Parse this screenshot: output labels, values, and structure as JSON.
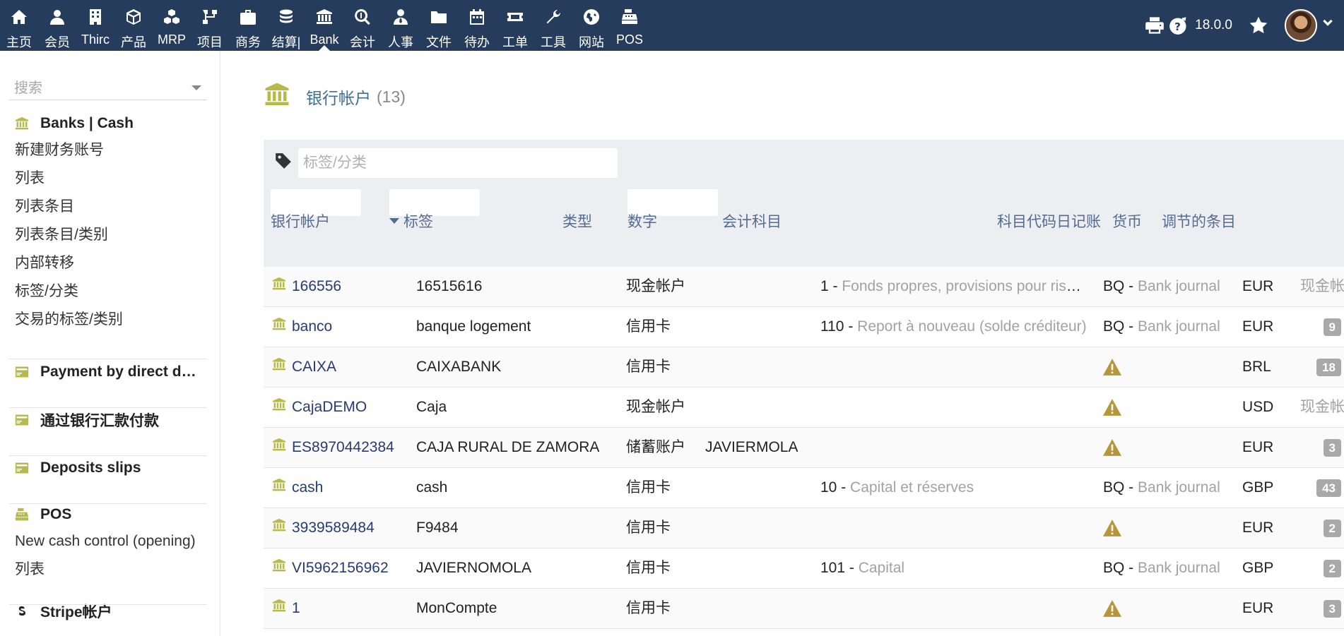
{
  "topnav": {
    "items": [
      {
        "label": "主页",
        "icon": "home-icon"
      },
      {
        "label": "会员",
        "icon": "user-icon"
      },
      {
        "label": "Thirc",
        "icon": "building-icon"
      },
      {
        "label": "产品",
        "icon": "cube-icon"
      },
      {
        "label": "MRP",
        "icon": "cubes-icon"
      },
      {
        "label": "项目",
        "icon": "sitemap-icon"
      },
      {
        "label": "商务",
        "icon": "suitcase-icon"
      },
      {
        "label": "结算|",
        "icon": "coins-icon"
      },
      {
        "label": "Bank",
        "icon": "bank-icon"
      },
      {
        "label": "会计",
        "icon": "search-dollar-icon"
      },
      {
        "label": "人事",
        "icon": "user-tie-icon"
      },
      {
        "label": "文件",
        "icon": "folder-icon"
      },
      {
        "label": "待办",
        "icon": "calendar-icon"
      },
      {
        "label": "工单",
        "icon": "ticket-icon"
      },
      {
        "label": "工具",
        "icon": "wrench-icon"
      },
      {
        "label": "网站",
        "icon": "globe-icon"
      },
      {
        "label": "POS",
        "icon": "cash-register-icon"
      }
    ],
    "active": "Bank"
  },
  "topright": {
    "version": "18.0.0"
  },
  "sidebar": {
    "search_placeholder": "搜索",
    "sections": [
      {
        "title": "Banks | Cash",
        "icon": "bank-icon",
        "links": [
          "新建财务账号",
          "列表",
          "列表条目",
          "列表条目/类别",
          "内部转移",
          "标签/分类",
          "交易的标签/类别"
        ]
      },
      {
        "title": "Payment by direct debit",
        "icon": "credit-card-icon",
        "links": []
      },
      {
        "title": "通过银行汇款付款",
        "icon": "credit-card-icon",
        "links": []
      },
      {
        "title": "Deposits slips",
        "icon": "credit-card-icon",
        "links": []
      },
      {
        "title": "POS",
        "icon": "cash-register-icon",
        "links": [
          "New cash control (opening)",
          "列表"
        ]
      },
      {
        "title": "Stripe帐户",
        "icon": "stripe-s-icon",
        "links": []
      }
    ]
  },
  "page": {
    "title": "银行帐户",
    "count": "(13)"
  },
  "filters": {
    "tag_placeholder": "标签/分类"
  },
  "table": {
    "headers": {
      "account": "银行帐户",
      "label": "标签",
      "type": "类型",
      "number": "数字",
      "accounting": "会计科目",
      "journal": "科目代码日记账",
      "currency": "货币",
      "adjust": "调节的条目"
    },
    "rows": [
      {
        "account": "166556",
        "label": "16515616",
        "type": "现金帐户",
        "number": "",
        "acc_code": "1 - ",
        "acc_name": "Fonds propres, provisions pour risques et charges",
        "jnl_code": "BQ - ",
        "jnl_name": "Bank journal",
        "warn": false,
        "currency": "EUR",
        "adjust": "现金帐户",
        "adjust_kind": "text"
      },
      {
        "account": "banco",
        "label": "banque logement",
        "type": "信用卡",
        "number": "",
        "acc_code": "110 - ",
        "acc_name": "Report à nouveau (solde créditeur)",
        "jnl_code": "BQ - ",
        "jnl_name": "Bank journal",
        "warn": false,
        "currency": "EUR",
        "adjust": "9",
        "adjust_kind": "badge"
      },
      {
        "account": "CAIXA",
        "label": "CAIXABANK",
        "type": "信用卡",
        "number": "",
        "acc_code": "",
        "acc_name": "",
        "jnl_code": "",
        "jnl_name": "",
        "warn": true,
        "currency": "BRL",
        "adjust": "18",
        "adjust_kind": "badge"
      },
      {
        "account": "CajaDEMO",
        "label": "Caja",
        "type": "现金帐户",
        "number": "",
        "acc_code": "",
        "acc_name": "",
        "jnl_code": "",
        "jnl_name": "",
        "warn": true,
        "currency": "USD",
        "adjust": "现金帐户",
        "adjust_kind": "text"
      },
      {
        "account": "ES8970442384",
        "label": "CAJA RURAL DE ZAMORA",
        "type": "储蓄账户",
        "number": "JAVIERMOLA",
        "acc_code": "",
        "acc_name": "",
        "jnl_code": "",
        "jnl_name": "",
        "warn": true,
        "currency": "EUR",
        "adjust": "3",
        "adjust_kind": "badge"
      },
      {
        "account": "cash",
        "label": "cash",
        "type": "信用卡",
        "number": "",
        "acc_code": "10 - ",
        "acc_name": "Capital et réserves",
        "jnl_code": "BQ - ",
        "jnl_name": "Bank journal",
        "warn": false,
        "currency": "GBP",
        "adjust": "43",
        "adjust_kind": "badge"
      },
      {
        "account": "3939589484",
        "label": "F9484",
        "type": "信用卡",
        "number": "",
        "acc_code": "",
        "acc_name": "",
        "jnl_code": "",
        "jnl_name": "",
        "warn": true,
        "currency": "EUR",
        "adjust": "2",
        "adjust_kind": "badge"
      },
      {
        "account": "VI5962156962",
        "label": "JAVIERNOMOLA",
        "type": "信用卡",
        "number": "",
        "acc_code": "101 - ",
        "acc_name": "Capital",
        "jnl_code": "BQ - ",
        "jnl_name": "Bank journal",
        "warn": false,
        "currency": "GBP",
        "adjust": "2",
        "adjust_kind": "badge"
      },
      {
        "account": "1",
        "label": "MonCompte",
        "type": "信用卡",
        "number": "",
        "acc_code": "",
        "acc_name": "",
        "jnl_code": "",
        "jnl_name": "",
        "warn": true,
        "currency": "EUR",
        "adjust": "3",
        "adjust_kind": "badge"
      }
    ]
  },
  "colors": {
    "topbar": "#263c5c",
    "accent": "#b7b94a",
    "link": "#263c70",
    "header_text": "#546c90",
    "warning": "#b7963a"
  }
}
